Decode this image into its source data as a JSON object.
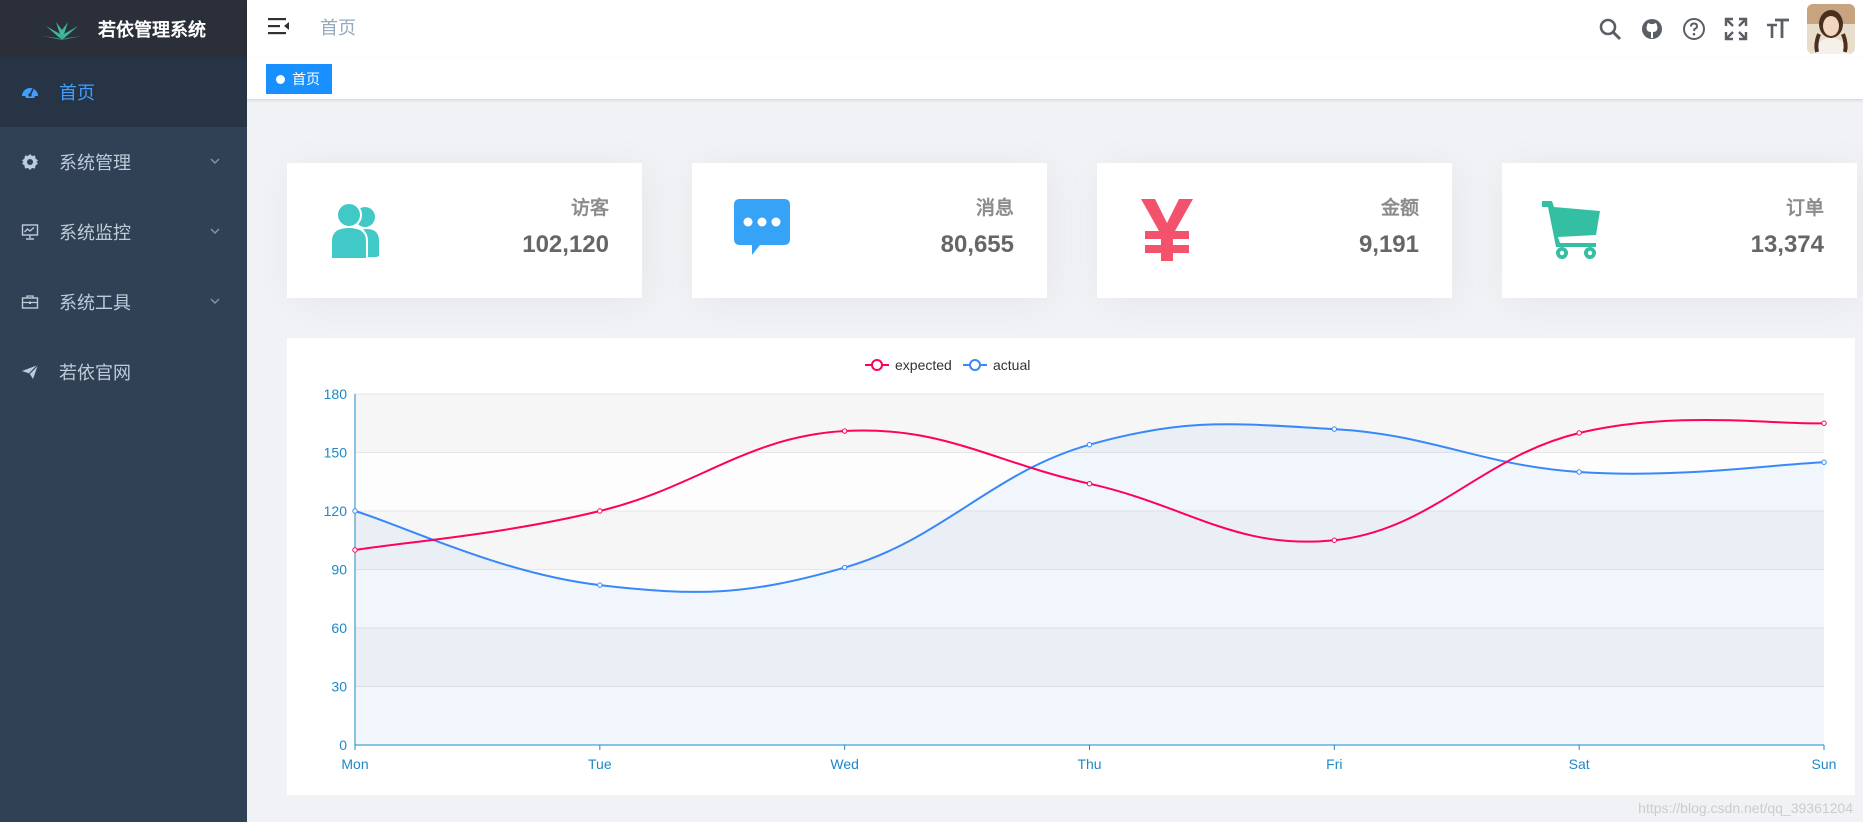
{
  "app": {
    "title": "若依管理系统"
  },
  "sidebar": {
    "items": [
      {
        "label": "首页",
        "icon": "dashboard-icon",
        "active": true
      },
      {
        "label": "系统管理",
        "icon": "gear-icon",
        "expandable": true
      },
      {
        "label": "系统监控",
        "icon": "monitor-icon",
        "expandable": true
      },
      {
        "label": "系统工具",
        "icon": "toolbox-icon",
        "expandable": true
      },
      {
        "label": "若依官网",
        "icon": "paper-plane-icon"
      }
    ]
  },
  "navbar": {
    "breadcrumb": "首页",
    "icons": [
      "search-icon",
      "github-icon",
      "question-icon",
      "fullscreen-icon",
      "font-size-icon"
    ]
  },
  "tags": [
    {
      "label": "首页",
      "active": true
    }
  ],
  "panels": [
    {
      "label": "访客",
      "value": "102,120",
      "icon": "people-icon",
      "color": "#40c9c6"
    },
    {
      "label": "消息",
      "value": "80,655",
      "icon": "message-icon",
      "color": "#36a3f7"
    },
    {
      "label": "金额",
      "value": "9,191",
      "icon": "money-icon",
      "color": "#f4516c"
    },
    {
      "label": "订单",
      "value": "13,374",
      "icon": "shopping-cart-icon",
      "color": "#34bfa3"
    }
  ],
  "chart_data": {
    "type": "line",
    "categories": [
      "Mon",
      "Tue",
      "Wed",
      "Thu",
      "Fri",
      "Sat",
      "Sun"
    ],
    "ylim": [
      0,
      180
    ],
    "yticks": [
      0,
      30,
      60,
      90,
      120,
      150,
      180
    ],
    "legend_position": "top-center",
    "series": [
      {
        "name": "expected",
        "values": [
          100,
          120,
          161,
          134,
          105,
          160,
          165
        ],
        "color": "#ff005a"
      },
      {
        "name": "actual",
        "values": [
          120,
          82,
          91,
          154,
          162,
          140,
          145
        ],
        "color": "#3888fa"
      }
    ]
  },
  "watermark": "https://blog.csdn.net/qq_39361204"
}
